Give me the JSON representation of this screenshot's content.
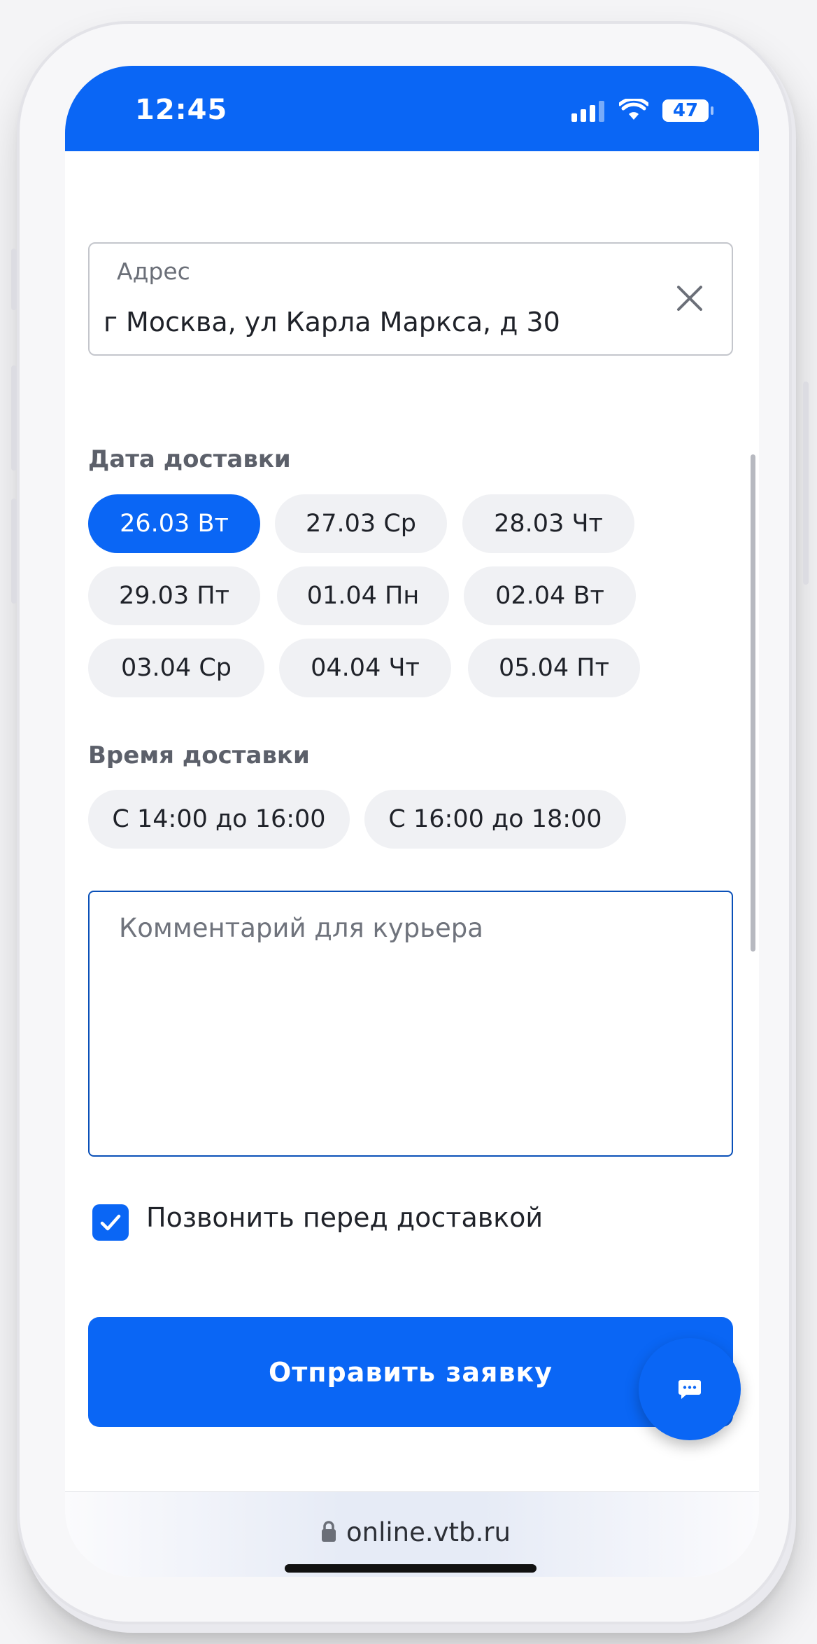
{
  "status_bar": {
    "time": "12:45",
    "battery": "47",
    "accent_color": "#0a66f5"
  },
  "form": {
    "address": {
      "label": "Адрес",
      "value": "г Москва, ул Карла Маркса, д 30"
    },
    "delivery_date": {
      "title": "Дата доставки",
      "options": [
        "26.03 Вт",
        "27.03 Ср",
        "28.03 Чт",
        "29.03 Пт",
        "01.04 Пн",
        "02.04 Вт",
        "03.04 Ср",
        "04.04 Чт",
        "05.04 Пт"
      ],
      "selected": "26.03 Вт"
    },
    "delivery_time": {
      "title": "Время доставки",
      "options": [
        "С 14:00 до 16:00",
        "С 16:00 до 18:00"
      ]
    },
    "comment": {
      "placeholder": "Комментарий для курьера",
      "value": ""
    },
    "call_before": {
      "label": "Позвонить перед доставкой",
      "checked": true
    },
    "submit_label": "Отправить заявку"
  },
  "browser": {
    "url": "online.vtb.ru"
  },
  "icons": {
    "clear": "close-icon",
    "chat": "chat-bubble-icon",
    "lock": "lock-icon",
    "signal": "cellular-signal-icon",
    "wifi": "wifi-icon",
    "battery": "battery-icon",
    "check": "checkmark-icon"
  }
}
